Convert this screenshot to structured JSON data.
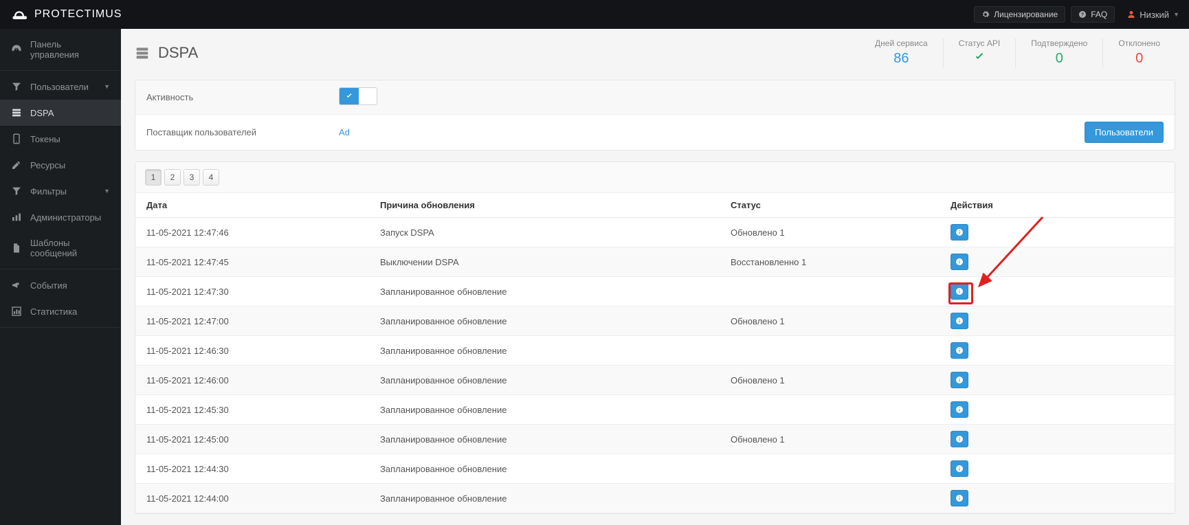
{
  "brand": "PROTECTIMUS",
  "topbar": {
    "licensing": "Лицензирование",
    "faq": "FAQ",
    "user_level": "Низкий"
  },
  "sidebar": {
    "items": [
      {
        "label": "Панель управления",
        "icon": "dashboard"
      },
      {
        "label": "Пользователи",
        "icon": "filter",
        "caret": true
      },
      {
        "label": "DSPA",
        "icon": "server",
        "active": true
      },
      {
        "label": "Токены",
        "icon": "tablet"
      },
      {
        "label": "Ресурсы",
        "icon": "edit"
      },
      {
        "label": "Фильтры",
        "icon": "filter",
        "caret": true
      },
      {
        "label": "Администраторы",
        "icon": "bars"
      },
      {
        "label": "Шаблоны сообщений",
        "icon": "doc"
      },
      {
        "label": "События",
        "icon": "bullhorn"
      },
      {
        "label": "Статистика",
        "icon": "chart"
      }
    ]
  },
  "page": {
    "title": "DSPA",
    "stats": [
      {
        "label": "Дней сервиса",
        "value": "86",
        "cls": "blue"
      },
      {
        "label": "Статус API",
        "value": "✓",
        "cls": "green",
        "is_check": true
      },
      {
        "label": "Подтверждено",
        "value": "0",
        "cls": "green"
      },
      {
        "label": "Отклонено",
        "value": "0",
        "cls": "red"
      }
    ],
    "props": {
      "activity_label": "Активность",
      "provider_label": "Поставщик пользователей",
      "provider_value": "Ad",
      "users_btn": "Пользователи"
    },
    "pagination": [
      "1",
      "2",
      "3",
      "4"
    ],
    "columns": {
      "date": "Дата",
      "reason": "Причина обновления",
      "status": "Статус",
      "actions": "Действия"
    },
    "rows": [
      {
        "date": "11-05-2021 12:47:46",
        "reason": "Запуск DSPA",
        "status": "Обновлено 1"
      },
      {
        "date": "11-05-2021 12:47:45",
        "reason": "Выключении DSPA",
        "status": "Восстановленно 1"
      },
      {
        "date": "11-05-2021 12:47:30",
        "reason": "Запланированное обновление",
        "status": ""
      },
      {
        "date": "11-05-2021 12:47:00",
        "reason": "Запланированное обновление",
        "status": "Обновлено 1"
      },
      {
        "date": "11-05-2021 12:46:30",
        "reason": "Запланированное обновление",
        "status": ""
      },
      {
        "date": "11-05-2021 12:46:00",
        "reason": "Запланированное обновление",
        "status": "Обновлено 1"
      },
      {
        "date": "11-05-2021 12:45:30",
        "reason": "Запланированное обновление",
        "status": ""
      },
      {
        "date": "11-05-2021 12:45:00",
        "reason": "Запланированное обновление",
        "status": "Обновлено 1"
      },
      {
        "date": "11-05-2021 12:44:30",
        "reason": "Запланированное обновление",
        "status": ""
      },
      {
        "date": "11-05-2021 12:44:00",
        "reason": "Запланированное обновление",
        "status": ""
      }
    ]
  }
}
